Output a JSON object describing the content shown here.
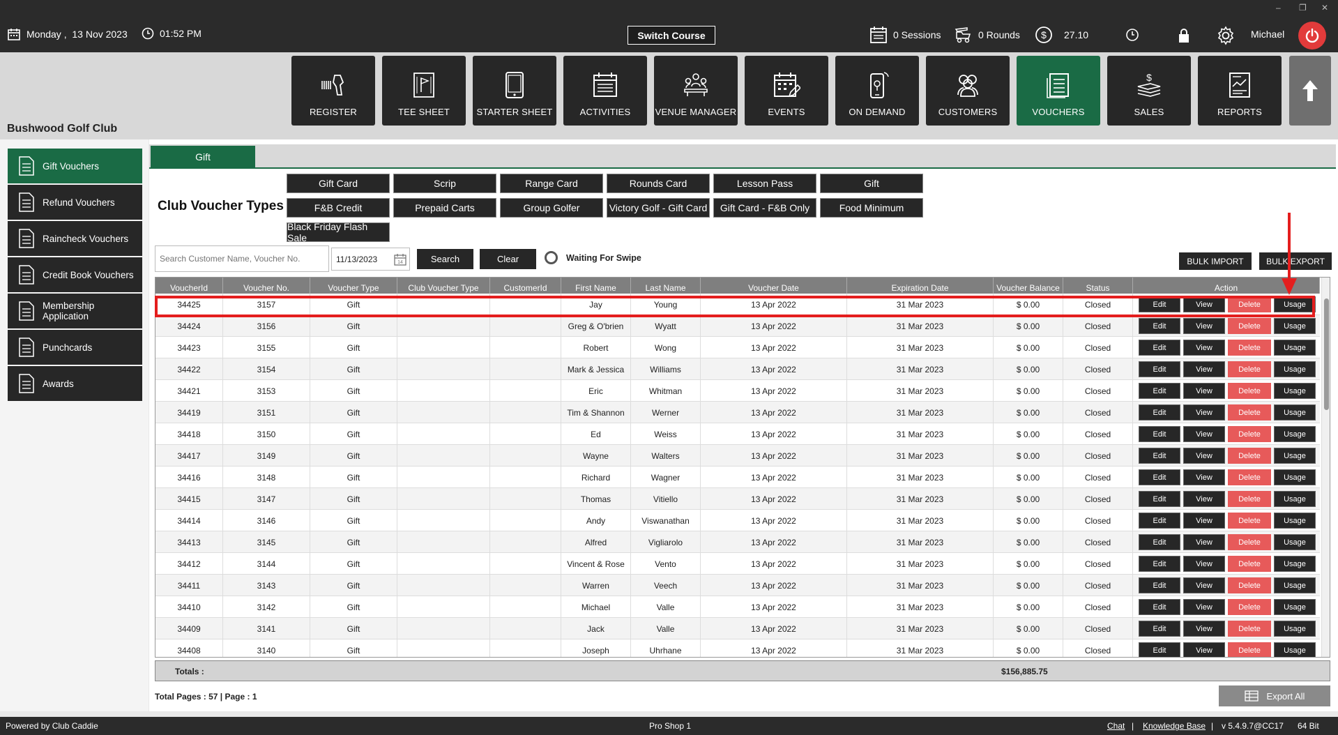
{
  "topbar": {
    "date": "Monday ,  13 Nov 2023",
    "time": "01:52 PM",
    "switch_course": "Switch Course",
    "sessions": "0 Sessions",
    "rounds": "0 Rounds",
    "balance": "27.10",
    "user": "Michael",
    "window_controls": {
      "minimize": "–",
      "restore": "❐",
      "close": "✕"
    }
  },
  "club_name": "Bushwood Golf Club",
  "nav": [
    {
      "label": "REGISTER",
      "icon": "barcode-scanner-icon"
    },
    {
      "label": "TEE SHEET",
      "icon": "flag-sheet-icon"
    },
    {
      "label": "STARTER SHEET",
      "icon": "tablet-icon"
    },
    {
      "label": "ACTIVITIES",
      "icon": "calendar-list-icon"
    },
    {
      "label": "VENUE MANAGER",
      "icon": "meeting-table-icon"
    },
    {
      "label": "EVENTS",
      "icon": "calendar-edit-icon"
    },
    {
      "label": "ON DEMAND",
      "icon": "phone-icon"
    },
    {
      "label": "CUSTOMERS",
      "icon": "people-icon"
    },
    {
      "label": "VOUCHERS",
      "icon": "voucher-list-icon",
      "active": true
    },
    {
      "label": "SALES",
      "icon": "money-stack-icon"
    },
    {
      "label": "REPORTS",
      "icon": "report-chart-icon"
    }
  ],
  "sidebar": [
    {
      "label": "Gift Vouchers",
      "active": true
    },
    {
      "label": "Refund Vouchers"
    },
    {
      "label": "Raincheck Vouchers"
    },
    {
      "label": "Credit Book Vouchers"
    },
    {
      "label": "Membership Application"
    },
    {
      "label": "Punchcards"
    },
    {
      "label": "Awards"
    }
  ],
  "tab": "Gift",
  "voucher_types_title": "Club Voucher Types",
  "voucher_types": [
    "Gift Card",
    "Scrip",
    "Range Card",
    "Rounds Card",
    "Lesson Pass",
    "Gift",
    "F&B Credit",
    "Prepaid Carts",
    "Group Golfer",
    "Victory Golf - Gift Card",
    "Gift Card - F&B Only",
    "Food Minimum",
    "Black Friday Flash Sale"
  ],
  "search": {
    "placeholder": "Search Customer Name, Voucher No.",
    "date": "11/13/2023",
    "search_label": "Search",
    "clear_label": "Clear",
    "waiting_label": "Waiting For Swipe",
    "bulk_import": "BULK IMPORT",
    "bulk_export": "BULK EXPORT"
  },
  "grid": {
    "columns": [
      "VoucherId",
      "Voucher No.",
      "Voucher Type",
      "Club Voucher Type",
      "CustomerId",
      "First Name",
      "Last Name",
      "Voucher Date",
      "Expiration Date",
      "Voucher Balance",
      "Status",
      "Action"
    ],
    "actions": [
      "Edit",
      "View",
      "Delete",
      "Usage"
    ],
    "rows": [
      [
        "34425",
        "3157",
        "Gift",
        "",
        "",
        "Jay",
        "Young",
        "13 Apr 2022",
        "31 Mar 2023",
        "$ 0.00",
        "Closed"
      ],
      [
        "34424",
        "3156",
        "Gift",
        "",
        "",
        "Greg & O'brien",
        "Wyatt",
        "13 Apr 2022",
        "31 Mar 2023",
        "$ 0.00",
        "Closed"
      ],
      [
        "34423",
        "3155",
        "Gift",
        "",
        "",
        "Robert",
        "Wong",
        "13 Apr 2022",
        "31 Mar 2023",
        "$ 0.00",
        "Closed"
      ],
      [
        "34422",
        "3154",
        "Gift",
        "",
        "",
        "Mark & Jessica",
        "Williams",
        "13 Apr 2022",
        "31 Mar 2023",
        "$ 0.00",
        "Closed"
      ],
      [
        "34421",
        "3153",
        "Gift",
        "",
        "",
        "Eric",
        "Whitman",
        "13 Apr 2022",
        "31 Mar 2023",
        "$ 0.00",
        "Closed"
      ],
      [
        "34419",
        "3151",
        "Gift",
        "",
        "",
        "Tim & Shannon",
        "Werner",
        "13 Apr 2022",
        "31 Mar 2023",
        "$ 0.00",
        "Closed"
      ],
      [
        "34418",
        "3150",
        "Gift",
        "",
        "",
        "Ed",
        "Weiss",
        "13 Apr 2022",
        "31 Mar 2023",
        "$ 0.00",
        "Closed"
      ],
      [
        "34417",
        "3149",
        "Gift",
        "",
        "",
        "Wayne",
        "Walters",
        "13 Apr 2022",
        "31 Mar 2023",
        "$ 0.00",
        "Closed"
      ],
      [
        "34416",
        "3148",
        "Gift",
        "",
        "",
        "Richard",
        "Wagner",
        "13 Apr 2022",
        "31 Mar 2023",
        "$ 0.00",
        "Closed"
      ],
      [
        "34415",
        "3147",
        "Gift",
        "",
        "",
        "Thomas",
        "Vitiello",
        "13 Apr 2022",
        "31 Mar 2023",
        "$ 0.00",
        "Closed"
      ],
      [
        "34414",
        "3146",
        "Gift",
        "",
        "",
        "Andy",
        "Viswanathan",
        "13 Apr 2022",
        "31 Mar 2023",
        "$ 0.00",
        "Closed"
      ],
      [
        "34413",
        "3145",
        "Gift",
        "",
        "",
        "Alfred",
        "Vigliarolo",
        "13 Apr 2022",
        "31 Mar 2023",
        "$ 0.00",
        "Closed"
      ],
      [
        "34412",
        "3144",
        "Gift",
        "",
        "",
        "Vincent & Rose",
        "Vento",
        "13 Apr 2022",
        "31 Mar 2023",
        "$ 0.00",
        "Closed"
      ],
      [
        "34411",
        "3143",
        "Gift",
        "",
        "",
        "Warren",
        "Veech",
        "13 Apr 2022",
        "31 Mar 2023",
        "$ 0.00",
        "Closed"
      ],
      [
        "34410",
        "3142",
        "Gift",
        "",
        "",
        "Michael",
        "Valle",
        "13 Apr 2022",
        "31 Mar 2023",
        "$ 0.00",
        "Closed"
      ],
      [
        "34409",
        "3141",
        "Gift",
        "",
        "",
        "Jack",
        "Valle",
        "13 Apr 2022",
        "31 Mar 2023",
        "$ 0.00",
        "Closed"
      ],
      [
        "34408",
        "3140",
        "Gift",
        "",
        "",
        "Joseph",
        "Uhrhane",
        "13 Apr 2022",
        "31 Mar 2023",
        "$ 0.00",
        "Closed"
      ]
    ]
  },
  "totals": {
    "label": "Totals :",
    "value": "$156,885.75"
  },
  "page_info": "Total Pages : 57 | Page : 1",
  "export_all": "Export All",
  "footer": {
    "powered": "Powered by Club Caddie",
    "location": "Pro Shop 1",
    "chat": "Chat",
    "sep": "|",
    "kb": "Knowledge Base",
    "version": "v 5.4.9.7@CC17",
    "bits": "64 Bit"
  },
  "colors": {
    "accent": "#1a6b45",
    "dark": "#272727",
    "delete": "#e75a5a",
    "highlight": "#e41e1e"
  }
}
